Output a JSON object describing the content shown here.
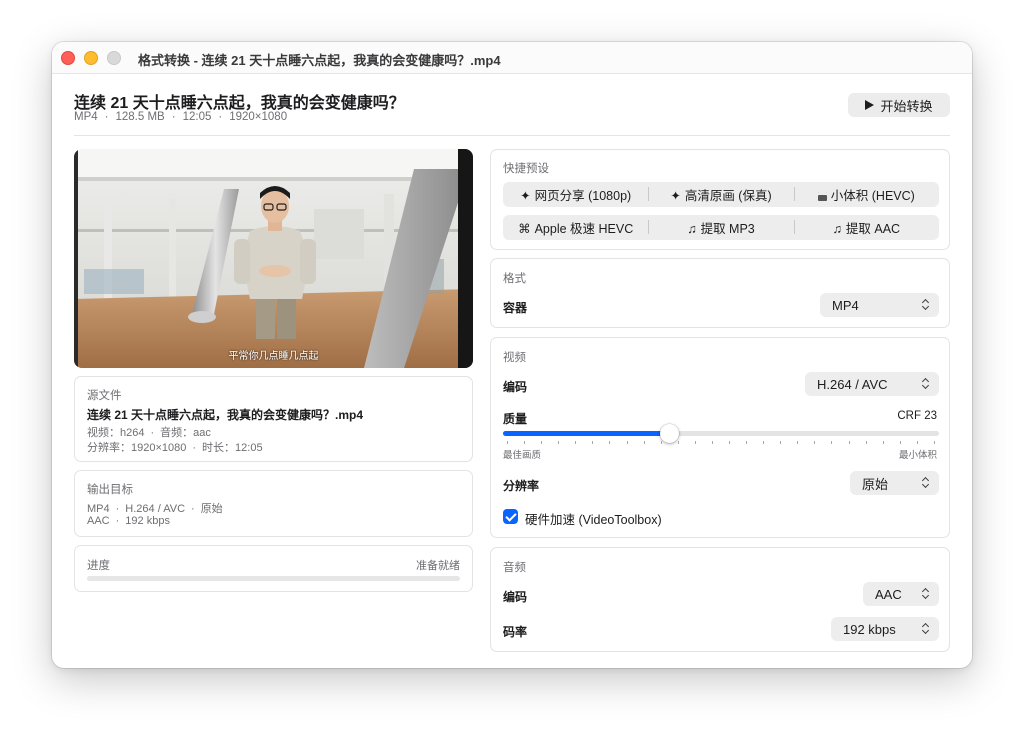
{
  "window": {
    "title": "格式转换 - 连续 21 天十点睡六点起，我真的会变健康吗？.mp4"
  },
  "header": {
    "title": "连续 21 天十点睡六点起，我真的会变健康吗？",
    "meta": [
      "MP4",
      "128.5 MB",
      "12:05",
      "1920×1080"
    ],
    "start_button": "开始转换"
  },
  "preview": {
    "subtitle": "平常你几点睡几点起"
  },
  "source_card": {
    "label": "源文件",
    "filename": "连续 21 天十点睡六点起，我真的会变健康吗？.mp4",
    "video_label": "视频：",
    "video_codec": "h264",
    "audio_label": "音频：",
    "audio_codec": "aac",
    "resolution_label": "分辨率：",
    "resolution": "1920×1080",
    "duration_label": "时长：",
    "duration": "12:05"
  },
  "output_card": {
    "label": "输出目标",
    "video_line": [
      "MP4",
      "H.264 / AVC",
      "原始"
    ],
    "audio_line": [
      "AAC",
      "192 kbps"
    ]
  },
  "progress": {
    "label": "进度",
    "status": "准备就绪",
    "value": 0
  },
  "presets": {
    "title": "快捷预设",
    "row1": [
      {
        "icon": "sparkle-icon",
        "glyph": "✦",
        "label": "网页分享 (1080p)"
      },
      {
        "icon": "sparkle-icon",
        "glyph": "✦",
        "label": "高清原画 (保真)"
      },
      {
        "icon": "archive-box-icon",
        "glyph": "",
        "label": "小体积 (HEVC)"
      }
    ],
    "row2": [
      {
        "icon": "command-icon",
        "glyph": "⌘",
        "label": "Apple 极速 HEVC"
      },
      {
        "icon": "music-note-icon",
        "glyph": "♫",
        "label": "提取 MP3"
      },
      {
        "icon": "music-note-icon",
        "glyph": "♫",
        "label": "提取 AAC"
      }
    ]
  },
  "format": {
    "title": "格式",
    "container_label": "容器",
    "container_value": "MP4"
  },
  "video": {
    "title": "视频",
    "codec_label": "编码",
    "codec_value": "H.264 / AVC",
    "quality_label": "质量",
    "crf_text": "CRF 23",
    "quality_fraction": 0.38,
    "min_caption": "最佳画质",
    "max_caption": "最小体积",
    "tick_count": 26,
    "resolution_label": "分辨率",
    "resolution_value": "原始",
    "hw_accel_label": "硬件加速 (VideoToolbox)",
    "hw_accel_checked": true
  },
  "audio": {
    "title": "音频",
    "codec_label": "编码",
    "codec_value": "AAC",
    "bitrate_label": "码率",
    "bitrate_value": "192 kbps"
  },
  "colors": {
    "accent": "#0a64ff",
    "close": "#ff5f57",
    "minimize": "#febc2e"
  }
}
